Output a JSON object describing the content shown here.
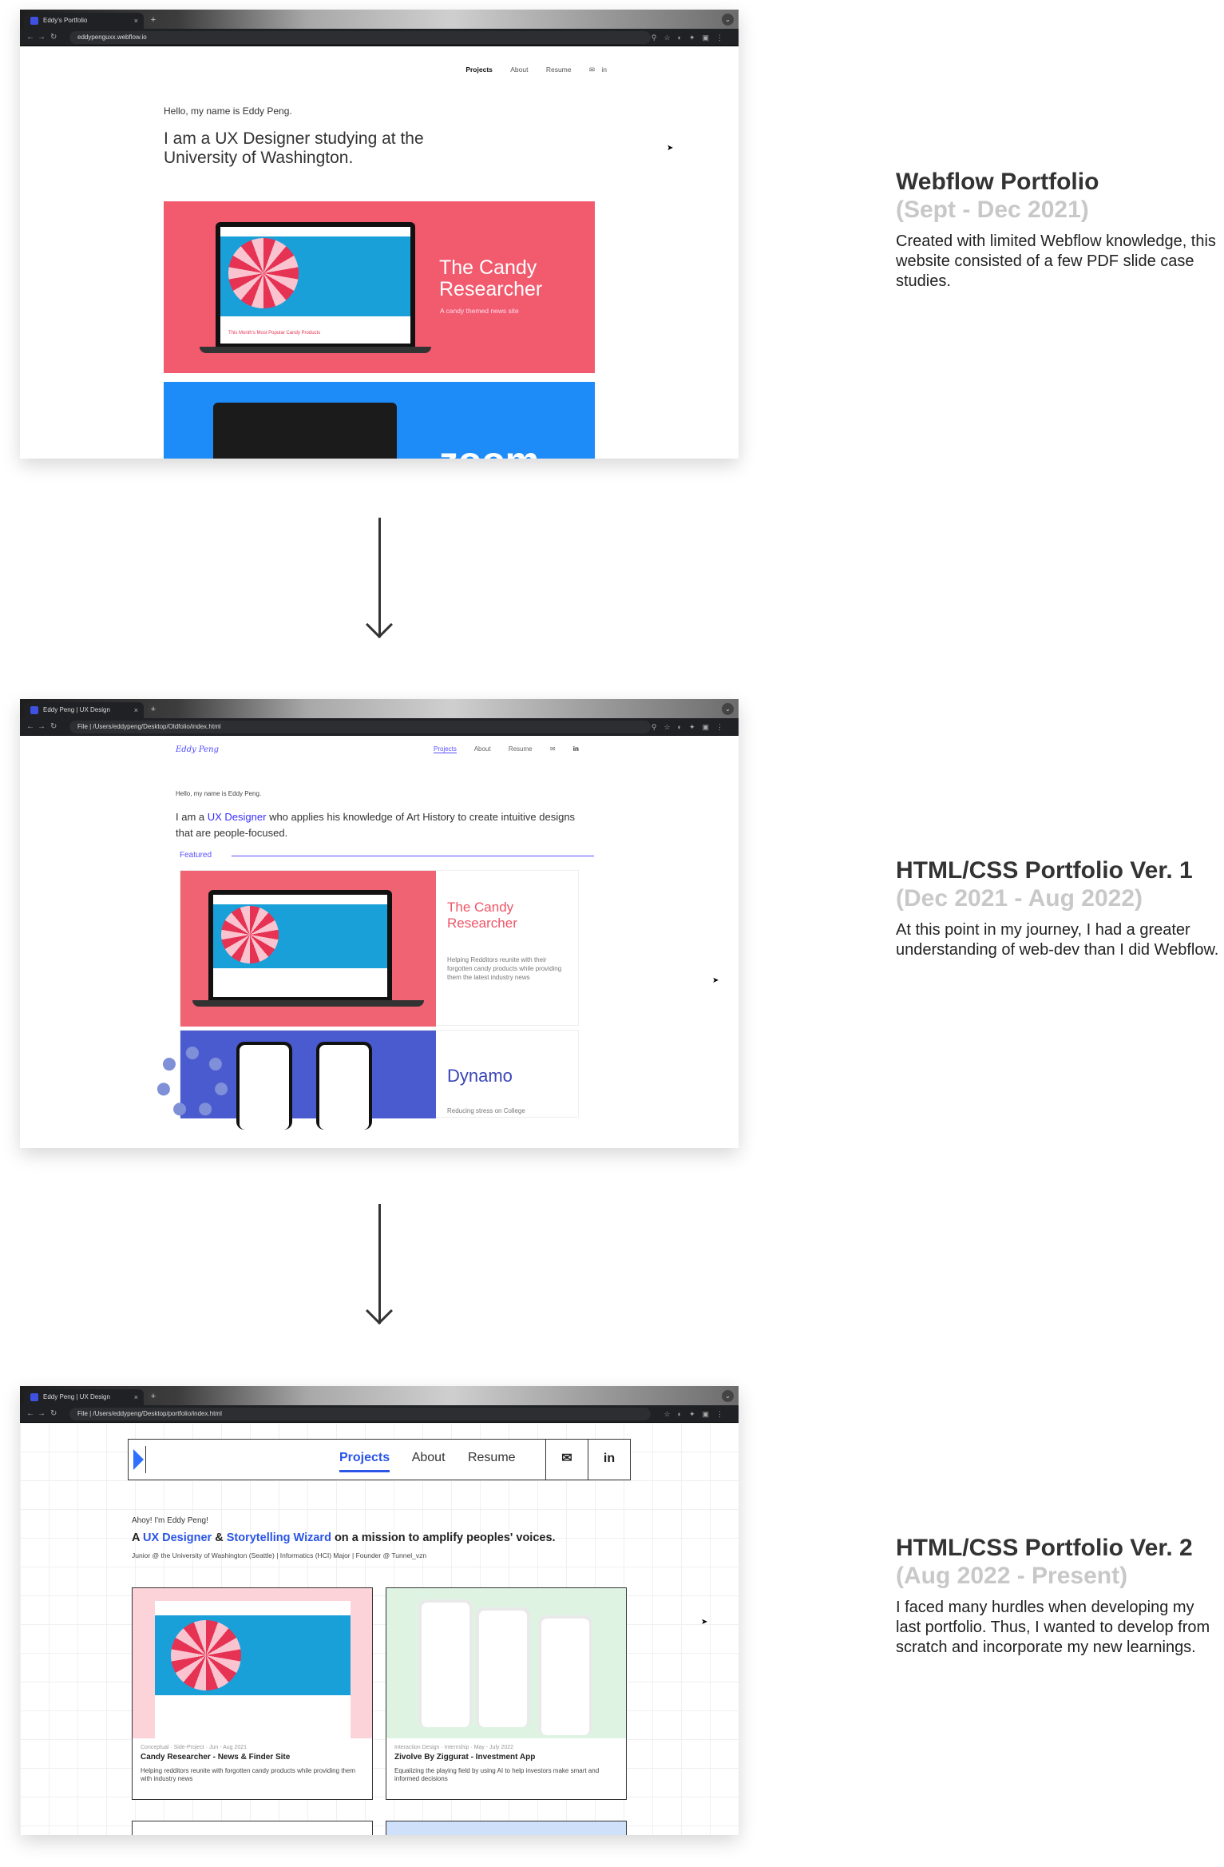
{
  "shot1": {
    "tab_title": "Eddy's Portfolio",
    "url": "eddypenguxx.webflow.io",
    "nav": [
      "Projects",
      "About",
      "Resume"
    ],
    "greeting": "Hello, my name is Eddy Peng.",
    "headline": "I am a UX Designer studying at the University of Washington.",
    "card1_title": "The Candy Researcher",
    "card1_sub": "A candy themed news site",
    "card1_popular": "This Month's Most Popular Candy Products",
    "card2_title": "zoom"
  },
  "shot2": {
    "tab_title": "Eddy Peng | UX Design",
    "url": "/Users/eddypeng/Desktop/Oldfolio/index.html",
    "url_prefix": "File",
    "logo": "Eddy Peng",
    "nav": [
      "Projects",
      "About",
      "Resume"
    ],
    "greeting": "Hello, my name is Eddy Peng.",
    "headline_pre": "I am a ",
    "headline_accent": "UX Designer",
    "headline_post": " who applies his knowledge of Art History to create intuitive designs that are people-focused.",
    "featured": "Featured",
    "card1_title": "The Candy Researcher",
    "card1_desc": "Helping Redditors reunite with their forgotten candy products while providing them the latest industry news",
    "card2_title": "Dynamo",
    "card2_desc": "Reducing stress on College"
  },
  "shot3": {
    "tab_title": "Eddy Peng | UX Design",
    "url": "/Users/eddypeng/Desktop/portfolio/index.html",
    "url_prefix": "File",
    "nav": [
      "Projects",
      "About",
      "Resume"
    ],
    "greeting": "Ahoy! I'm Eddy Peng!",
    "head_a": "A ",
    "head_role1": "UX Designer",
    "head_amp": " & ",
    "head_role2": "Storytelling Wizard",
    "head_rest": " on a mission to amplify peoples' voices.",
    "subline": "Junior @ the University of Washington (Seattle) | Informatics (HCI) Major | Founder @ Tunnel_vzn",
    "cards": [
      {
        "meta": "Conceptual · Side-Project · Jun - Aug 2021",
        "title": "Candy Researcher - News & Finder Site",
        "desc": "Helping redditors reunite with forgotten candy products while providing them with industry news"
      },
      {
        "meta": "Interaction Design · Internship · May - July 2022",
        "title": "Zivolve By Ziggurat - Investment App",
        "desc": "Equalizing the playing field by using AI to help investors make smart and informed decisions"
      }
    ]
  },
  "notes": [
    {
      "title": "Webflow Portfolio",
      "dates": "(Sept - Dec 2021)",
      "body": "Created with limited Webflow knowledge, this website consisted of a few PDF slide case studies."
    },
    {
      "title": "HTML/CSS Portfolio Ver. 1",
      "dates": "(Dec 2021 - Aug 2022)",
      "body": "At this point in my journey, I had a greater understanding of web-dev than I did Webflow."
    },
    {
      "title": "HTML/CSS Portfolio Ver. 2",
      "dates": "(Aug 2022 - Present)",
      "body": "I faced many hurdles when developing my last portfolio. Thus, I wanted to develop from scratch and incorporate my new learnings."
    }
  ],
  "icons": {
    "close": "×",
    "new_tab": "+",
    "mail": "✉",
    "linkedin": "in",
    "arrow": "arrow-down-icon"
  },
  "colors": {
    "candy_pink": "#f25a6e",
    "zoom_blue": "#1e8cf8",
    "accent_purple": "#5a4fff",
    "accent_blue": "#2a55e6"
  }
}
